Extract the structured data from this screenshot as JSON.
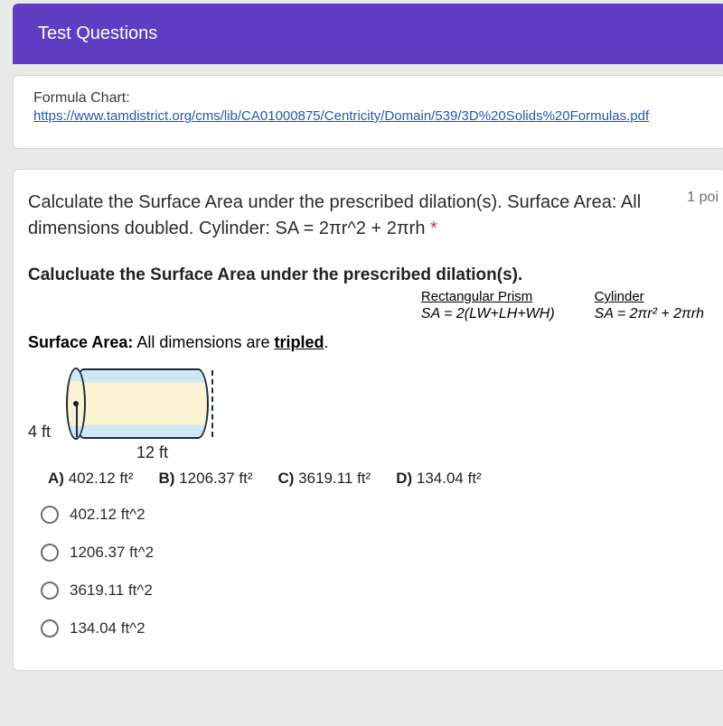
{
  "header": {
    "title": "Test Questions"
  },
  "formula_chart": {
    "label": "Formula Chart:",
    "link": "https://www.tamdistrict.org/cms/lib/CA01000875/Centricity/Domain/539/3D%20Solids%20Formulas.pdf"
  },
  "question": {
    "text_part1": "Calculate the Surface Area under the prescribed dilation(s). Surface Area: All dimensions doubled. Cylinder: SA = 2πr^2 + 2πrh ",
    "asterisk": "*",
    "points": "1 poi",
    "sub_heading": "Calucluate the Surface Area under the prescribed dilation(s).",
    "formulas": {
      "rect": {
        "name": "Rectangular Prism",
        "formula": "SA = 2(LW+LH+WH)"
      },
      "cyl": {
        "name": "Cylinder",
        "formula": "SA = 2πr² + 2πrh"
      }
    },
    "sa_label": "Surface Area:",
    "sa_text": "  All dimensions are ",
    "sa_underlined": "tripled",
    "sa_period": ".",
    "dimensions": {
      "radius": "4 ft",
      "length": "12 ft"
    },
    "inline_choices": [
      {
        "label": "A)",
        "value": "402.12 ft²"
      },
      {
        "label": "B)",
        "value": "1206.37 ft²"
      },
      {
        "label": "C)",
        "value": "3619.11 ft²"
      },
      {
        "label": "D)",
        "value": "134.04 ft²"
      }
    ],
    "radio_options": [
      "402.12 ft^2",
      "1206.37 ft^2",
      "3619.11 ft^2",
      "134.04 ft^2"
    ]
  }
}
